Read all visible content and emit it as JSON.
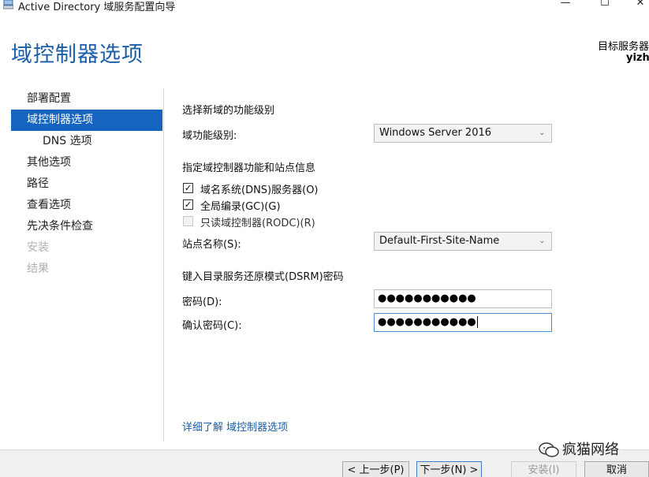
{
  "window": {
    "title": "Active Directory 域服务配置向导",
    "minimize": "—",
    "maximize": "☐",
    "close": "✕"
  },
  "header": {
    "page_title": "域控制器选项",
    "target_label": "目标服务器",
    "target_name": "yizhi"
  },
  "nav": {
    "items": [
      {
        "label": "部署配置",
        "state": "normal"
      },
      {
        "label": "域控制器选项",
        "state": "active"
      },
      {
        "label": "DNS 选项",
        "state": "sub"
      },
      {
        "label": "其他选项",
        "state": "normal"
      },
      {
        "label": "路径",
        "state": "normal"
      },
      {
        "label": "查看选项",
        "state": "normal"
      },
      {
        "label": "先决条件检查",
        "state": "normal"
      },
      {
        "label": "安装",
        "state": "disabled"
      },
      {
        "label": "结果",
        "state": "disabled"
      }
    ]
  },
  "form": {
    "functional_level_heading": "选择新域的功能级别",
    "domain_level_label": "域功能级别:",
    "domain_level_value": "Windows Server 2016",
    "capabilities_heading": "指定域控制器功能和站点信息",
    "dns_label": "域名系统(DNS)服务器(O)",
    "dns_checked": true,
    "gc_label": "全局编录(GC)(G)",
    "gc_checked": true,
    "rodc_label": "只读域控制器(RODC)(R)",
    "rodc_checked": false,
    "site_label": "站点名称(S):",
    "site_value": "Default-First-Site-Name",
    "dsrm_heading": "键入目录服务还原模式(DSRM)密码",
    "password_label": "密码(D):",
    "password_value": "●●●●●●●●●●●",
    "confirm_label": "确认密码(C):",
    "confirm_value": "●●●●●●●●●●●",
    "check_mark": "✓",
    "chevron": "⌄"
  },
  "learn_more": "详细了解 域控制器选项",
  "footer": {
    "prev": "< 上一步(P)",
    "next": "下一步(N) >",
    "install": "安装(I)",
    "cancel": "取消"
  },
  "watermark": "疯猫网络",
  "colors": {
    "accent": "#1565c0",
    "title_blue": "#1a5da8"
  }
}
